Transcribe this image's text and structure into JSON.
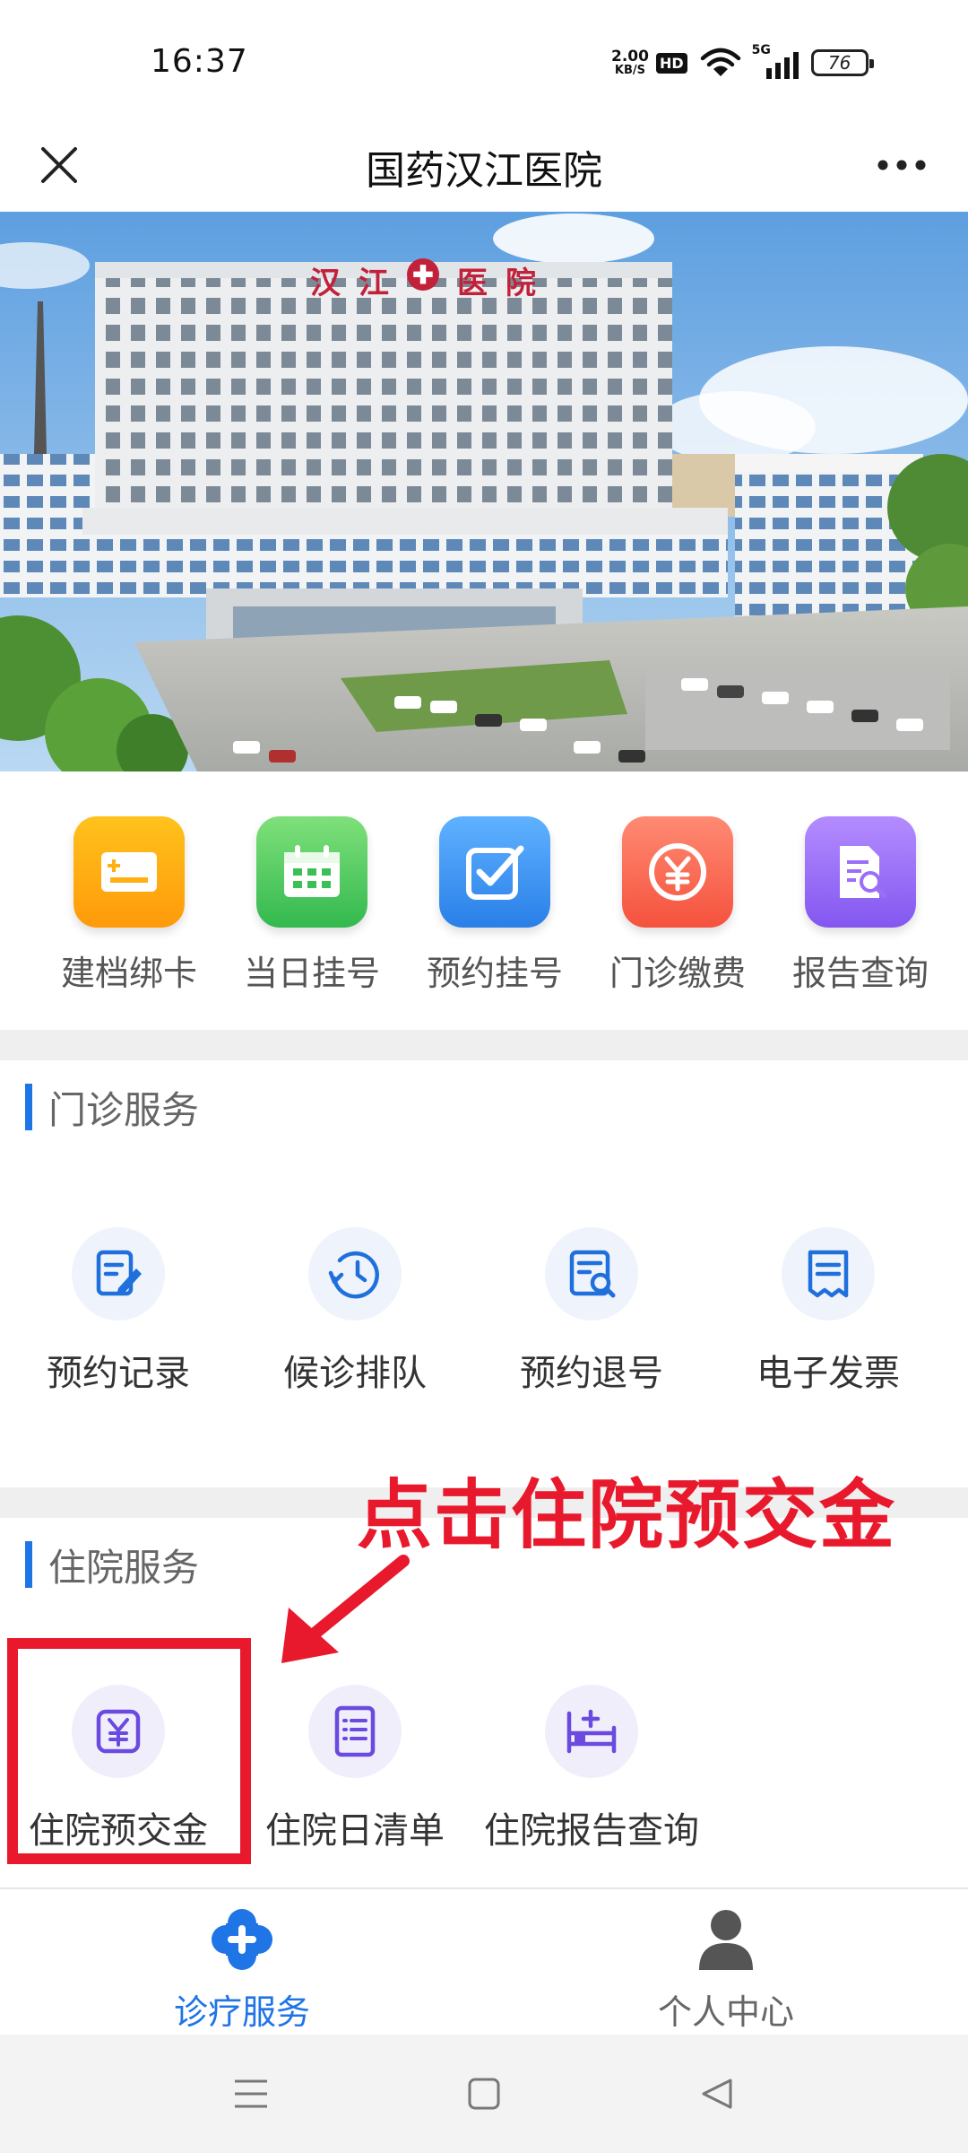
{
  "status_bar": {
    "time": "16:37",
    "net_speed_value": "2.00",
    "net_speed_unit": "KB/S",
    "hd_label": "HD",
    "network_type": "5G",
    "battery_level": "76",
    "icons": [
      "wifi-icon",
      "signal-icon",
      "battery-icon"
    ]
  },
  "header": {
    "title": "国药汉江医院",
    "close_icon": "close-icon",
    "more_icon": "more-icon"
  },
  "banner": {
    "sign_text": [
      "汉",
      "江",
      "医",
      "院"
    ],
    "sky_color": "#7fb6e8",
    "building_color": "#e9ecef"
  },
  "quick_actions": [
    {
      "label": "建档绑卡",
      "icon": "card-icon",
      "color_from": "#ffc21c",
      "color_to": "#ff9a0a"
    },
    {
      "label": "当日挂号",
      "icon": "calendar-icon",
      "color_from": "#7fe07a",
      "color_to": "#33b94f"
    },
    {
      "label": "预约挂号",
      "icon": "checkbox-icon",
      "color_from": "#5fb2ff",
      "color_to": "#2a7fe8"
    },
    {
      "label": "门诊缴费",
      "icon": "yen-coin-icon",
      "color_from": "#ff8a73",
      "color_to": "#f5523d"
    },
    {
      "label": "报告查询",
      "icon": "report-search-icon",
      "color_from": "#b48cff",
      "color_to": "#8357f0"
    }
  ],
  "outpatient": {
    "title": "门诊服务",
    "items": [
      {
        "label": "预约记录",
        "icon": "edit-record-icon"
      },
      {
        "label": "候诊排队",
        "icon": "clock-queue-icon"
      },
      {
        "label": "预约退号",
        "icon": "search-doc-icon"
      },
      {
        "label": "电子发票",
        "icon": "invoice-icon"
      }
    ]
  },
  "inpatient": {
    "title": "住院服务",
    "items": [
      {
        "label": "住院预交金",
        "icon": "yen-deposit-icon"
      },
      {
        "label": "住院日清单",
        "icon": "list-doc-icon"
      },
      {
        "label": "住院报告查询",
        "icon": "bed-icon"
      }
    ]
  },
  "annotation": {
    "text": "点击住院预交金",
    "color": "#e8192c"
  },
  "tab_bar": {
    "tabs": [
      {
        "label": "诊疗服务",
        "icon": "medical-cross-icon",
        "active": true
      },
      {
        "label": "个人中心",
        "icon": "person-icon",
        "active": false
      }
    ],
    "active_color": "#1f74e6",
    "inactive_color": "#666666"
  },
  "nav_bar": {
    "icons": [
      "menu-icon",
      "home-icon",
      "back-icon"
    ]
  }
}
